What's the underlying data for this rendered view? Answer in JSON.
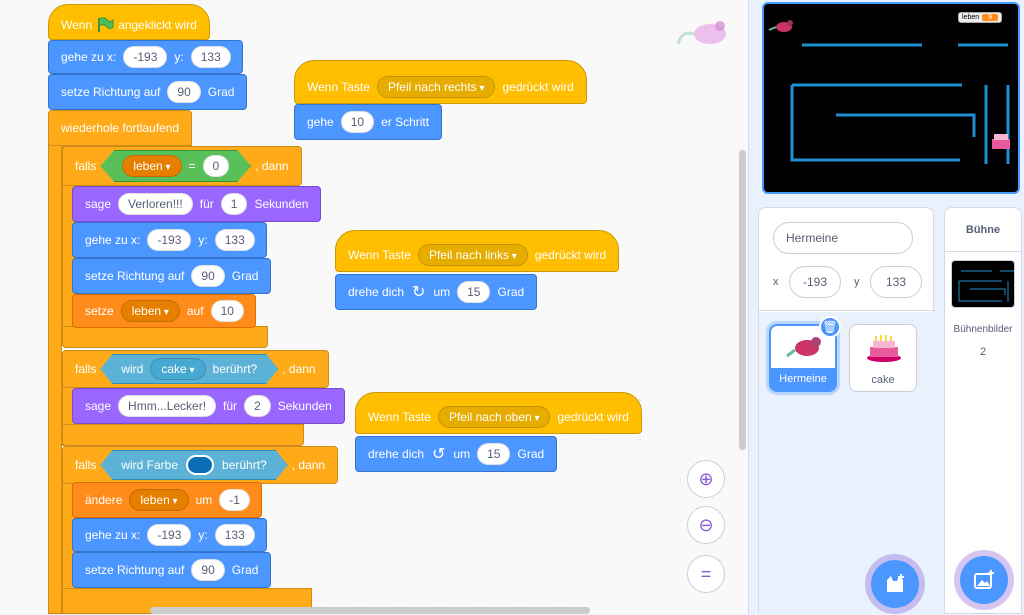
{
  "scripts": {
    "main": {
      "hat": {
        "pre": "Wenn",
        "post": "angeklickt wird"
      },
      "goto1": {
        "label": "gehe zu x:",
        "x": "-193",
        "ylabel": "y:",
        "y": "133"
      },
      "dir1": {
        "label": "setze Richtung auf",
        "value": "90",
        "unit": "Grad"
      },
      "forever": "wiederhole fortlaufend",
      "if1": {
        "falls": "falls",
        "var": "leben",
        "eq": "=",
        "value": "0",
        "dann": ", dann"
      },
      "say1": {
        "label": "sage",
        "text": "Verloren!!!",
        "fur": "für",
        "secs": "1",
        "unit": "Sekunden"
      },
      "goto2": {
        "label": "gehe zu x:",
        "x": "-193",
        "ylabel": "y:",
        "y": "133"
      },
      "dir2": {
        "label": "setze Richtung auf",
        "value": "90",
        "unit": "Grad"
      },
      "set1": {
        "label": "setze",
        "var": "leben",
        "auf": "auf",
        "value": "10"
      },
      "if2": {
        "falls": "falls",
        "pre": "wird",
        "obj": "cake",
        "post": "berührt?",
        "dann": ", dann"
      },
      "say2": {
        "label": "sage",
        "text": "Hmm...Lecker!",
        "fur": "für",
        "secs": "2",
        "unit": "Sekunden"
      },
      "if3": {
        "falls": "falls",
        "pre": "wird Farbe",
        "post": "berührt?",
        "dann": ", dann",
        "color": "#0a6db5"
      },
      "change1": {
        "label": "ändere",
        "var": "leben",
        "um": "um",
        "value": "-1"
      },
      "goto3": {
        "label": "gehe zu x:",
        "x": "-193",
        "ylabel": "y:",
        "y": "133"
      },
      "dir3": {
        "label": "setze Richtung auf",
        "value": "90",
        "unit": "Grad"
      }
    },
    "right": {
      "pre": "Wenn Taste",
      "key": "Pfeil nach rechts",
      "post": "gedrückt wird",
      "move": "gehe",
      "steps": "10",
      "unit": "er Schritt"
    },
    "left": {
      "pre": "Wenn Taste",
      "key": "Pfeil nach links",
      "post": "gedrückt wird",
      "turn": "drehe dich",
      "um": "um",
      "deg": "15",
      "unit": "Grad"
    },
    "up": {
      "pre": "Wenn Taste",
      "key": "Pfeil nach oben",
      "post": "gedrückt wird",
      "turn": "drehe dich",
      "um": "um",
      "deg": "15",
      "unit": "Grad"
    }
  },
  "zoom": {
    "in": "+",
    "out": "−",
    "reset": "="
  },
  "stage": {
    "monitor_label": "leben",
    "monitor_value": "9"
  },
  "sprite_info": {
    "name": "Hermeine",
    "x_label": "x",
    "x": "-193",
    "y_label": "y",
    "y": "133"
  },
  "sprites": [
    {
      "name": "Hermeine"
    },
    {
      "name": "cake"
    }
  ],
  "stage_panel": {
    "title": "Bühne",
    "backdrops_label": "Bühnenbilder",
    "backdrops_count": "2"
  },
  "colors": {
    "event": "#ffbf00",
    "motion": "#4c97ff",
    "looks": "#9966ff",
    "control": "#ffab19",
    "variable": "#ff8c1a",
    "sensing": "#5cb1d6",
    "operator": "#59c059",
    "maze": "#1f8fd1"
  }
}
